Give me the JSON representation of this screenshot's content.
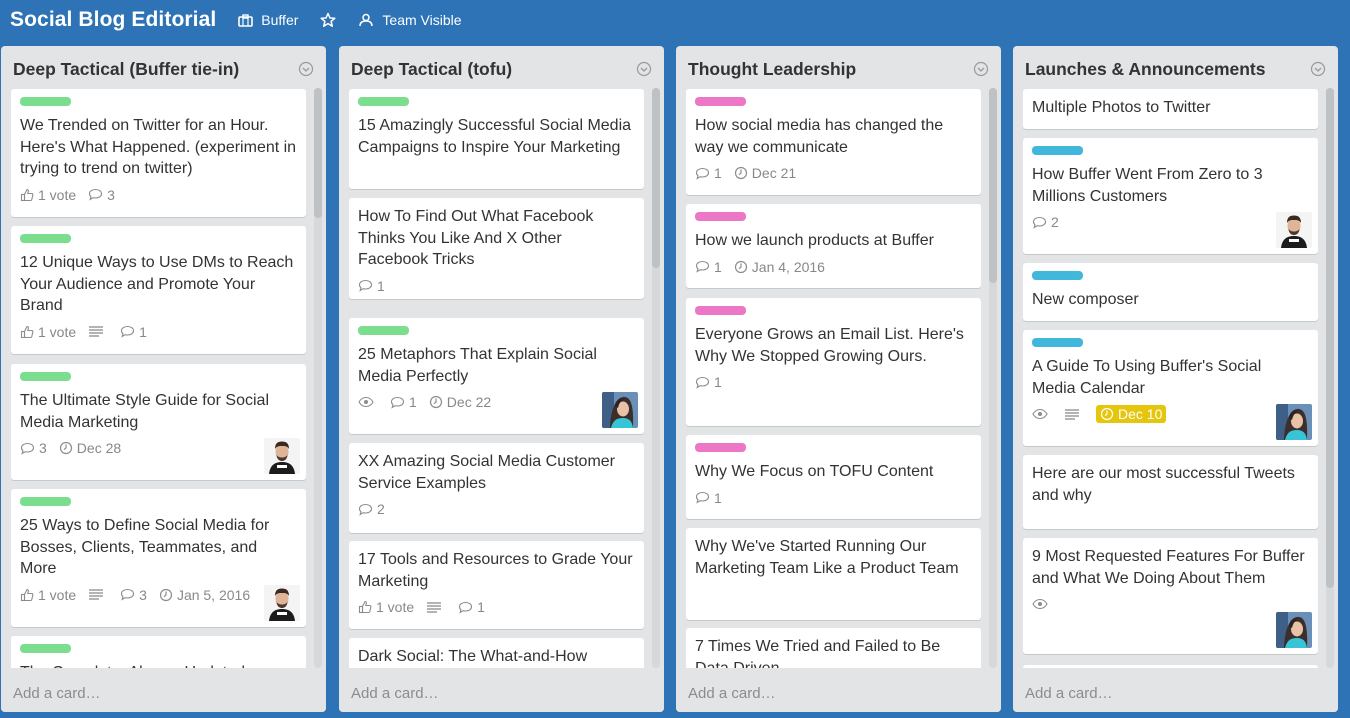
{
  "board": {
    "title": "Social Blog Editorial",
    "team": "Buffer",
    "visibility": "Team Visible"
  },
  "add_card_label": "Add a card…",
  "colors": {
    "background": "#2d73b5",
    "green": "#7bde8f",
    "pink": "#ec77c6",
    "blue": "#42b7dc",
    "due_soon": "#e6c60d"
  },
  "lists": [
    {
      "title": "Deep Tactical (Buffer tie-in)",
      "cards": [
        {
          "label": "green",
          "title": "We Trended on Twitter for an Hour. Here's What Happened. (experiment in trying to trend on twitter)",
          "votes": "1 vote",
          "comments": "3"
        },
        {
          "label": "green",
          "title": "12 Unique Ways to Use DMs to Reach Your Audience and Promote Your Brand",
          "votes": "1 vote",
          "description": true,
          "comments": "1"
        },
        {
          "label": "green",
          "title": "The Ultimate Style Guide for Social Media Marketing",
          "comments": "3",
          "due": "Dec 28",
          "avatar": "man"
        },
        {
          "label": "green",
          "title": "25 Ways to Define Social Media for Bosses, Clients, Teammates, and More",
          "votes": "1 vote",
          "description": true,
          "comments": "3",
          "due": "Jan 5, 2016",
          "avatar": "man"
        },
        {
          "label": "green",
          "title": "The Complete, Always-Updated"
        }
      ]
    },
    {
      "title": "Deep Tactical (tofu)",
      "cards": [
        {
          "label": "green",
          "title": "15 Amazingly Successful Social Media Campaigns to Inspire Your Marketing"
        },
        {
          "title": "How To Find Out What Facebook Thinks You Like And X Other Facebook Tricks",
          "comments": "1"
        },
        {
          "label": "green",
          "title": "25 Metaphors That Explain Social Media Perfectly",
          "watch": true,
          "comments": "1",
          "due": "Dec 22",
          "avatar": "woman"
        },
        {
          "title": "XX Amazing Social Media Customer Service Examples",
          "comments": "2"
        },
        {
          "title": "17 Tools and Resources to Grade Your Marketing",
          "votes": "1 vote",
          "description": true,
          "comments": "1"
        },
        {
          "title": "Dark Social: The What-and-How"
        }
      ]
    },
    {
      "title": "Thought Leadership",
      "cards": [
        {
          "label": "pink",
          "title": "How social media has changed the way we communicate",
          "comments": "1",
          "due": "Dec 21"
        },
        {
          "label": "pink",
          "title": "How we launch products at Buffer",
          "comments": "1",
          "due": "Jan 4, 2016"
        },
        {
          "label": "pink",
          "title": "Everyone Grows an Email List. Here's Why We Stopped Growing Ours.",
          "comments": "1"
        },
        {
          "label": "pink",
          "title": "Why We Focus on TOFU Content",
          "comments": "1"
        },
        {
          "title": "Why We've Started Running Our Marketing Team Like a Product Team"
        },
        {
          "title": "7 Times We Tried and Failed to Be Data Driven"
        }
      ]
    },
    {
      "title": "Launches & Announcements",
      "cards": [
        {
          "title": "Multiple Photos to Twitter"
        },
        {
          "label": "blue",
          "title": "How Buffer Went From Zero to 3 Millions Customers",
          "comments": "2",
          "avatar": "man"
        },
        {
          "label": "blue",
          "title": "New composer"
        },
        {
          "label": "blue",
          "title": "A Guide To Using Buffer's Social Media Calendar",
          "watch": true,
          "description": true,
          "due": "Dec 10",
          "due_state": "soon",
          "avatar": "woman"
        },
        {
          "title": "Here are our most successful Tweets and why"
        },
        {
          "title": "9 Most Requested Features For Buffer and What We Doing About Them",
          "watch": true,
          "avatar": "woman"
        },
        {
          "label": "blue",
          "title": ""
        }
      ]
    }
  ]
}
